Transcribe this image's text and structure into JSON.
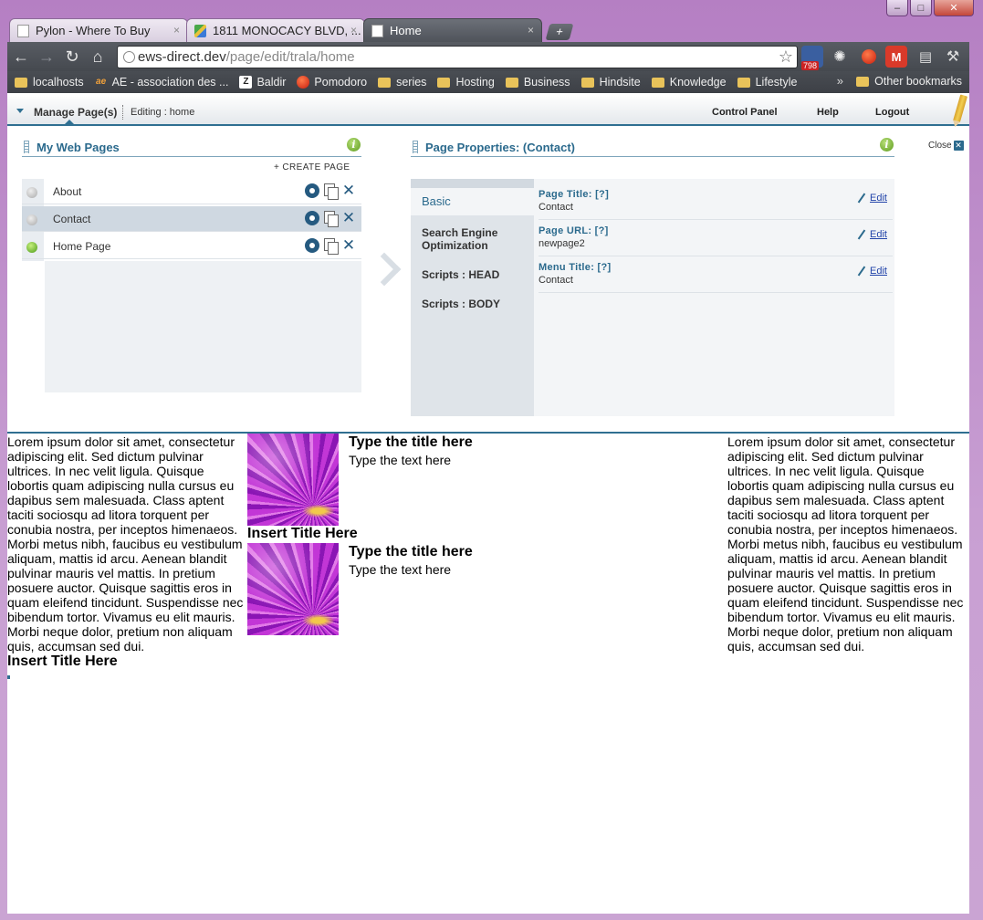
{
  "window": {
    "controls": {
      "minimize": "–",
      "maximize": "□",
      "close": "✕"
    }
  },
  "tabs": [
    {
      "title": "Pylon - Where To Buy",
      "icon": "page-icon",
      "close": "×"
    },
    {
      "title": "1811 MONOCACY BLVD, ...",
      "icon": "google-maps-icon",
      "close": "×"
    },
    {
      "title": "Home",
      "icon": "page-icon",
      "close": "×",
      "active": true
    }
  ],
  "new_tab": "+",
  "toolbar": {
    "back": "←",
    "forward": "→",
    "reload": "↻",
    "home": "⌂",
    "url_host": "ews-direct.dev",
    "url_path": "/page/edit/trala/home",
    "star": "☆",
    "rss_count": "798"
  },
  "bookmarks": {
    "items": [
      {
        "label": "localhosts",
        "icon": "folder-icon"
      },
      {
        "label": "AE - association des ...",
        "icon": "ae-logo-icon",
        "glyph": "ae"
      },
      {
        "label": "Baldir",
        "icon": "zotero-icon",
        "glyph": "Z"
      },
      {
        "label": "Pomodoro",
        "icon": "tomato-icon"
      },
      {
        "label": "series",
        "icon": "folder-icon"
      },
      {
        "label": "Hosting",
        "icon": "folder-icon"
      },
      {
        "label": "Business",
        "icon": "folder-icon"
      },
      {
        "label": "Hindsite",
        "icon": "folder-icon"
      },
      {
        "label": "Knowledge",
        "icon": "folder-icon"
      },
      {
        "label": "Lifestyle",
        "icon": "folder-icon"
      }
    ],
    "overflow": "»",
    "other": "Other bookmarks"
  },
  "cms": {
    "manage_label": "Manage Page(s)",
    "editing": "Editing : home",
    "links": [
      "Control Panel",
      "Help",
      "Logout"
    ]
  },
  "pages_panel": {
    "title": "My Web Pages",
    "create": "+ CREATE PAGE",
    "pages": [
      {
        "name": "About",
        "status": "inactive"
      },
      {
        "name": "Contact",
        "status": "inactive",
        "selected": true
      },
      {
        "name": "Home Page",
        "status": "active"
      }
    ]
  },
  "props_panel": {
    "title": "Page Properties: (Contact)",
    "close": "Close",
    "nav": [
      "Basic",
      "Search Engine Optimization",
      "Scripts : HEAD",
      "Scripts : BODY"
    ],
    "fields": [
      {
        "label": "Page Title: [?]",
        "value": "Contact",
        "edit": "Edit"
      },
      {
        "label": "Page URL: [?]",
        "value": "newpage2",
        "edit": "Edit"
      },
      {
        "label": "Menu Title: [?]",
        "value": "Contact",
        "edit": "Edit"
      }
    ]
  },
  "content": {
    "lorem_left": "Lorem ipsum dolor sit amet, consectetur adipiscing elit. Sed dictum pulvinar ultrices. In nec velit ligula. Quisque lobortis quam adipiscing nulla cursus eu dapibus sem malesuada. Class aptent taciti sociosqu ad litora torquent per conubia nostra, per inceptos himenaeos. Morbi metus nibh, faucibus eu vestibulum aliquam, mattis id arcu. Aenean blandit pulvinar mauris vel mattis. In pretium posuere auctor. Quisque sagittis eros in quam eleifend tincidunt. Suspendisse nec bibendum tortor. Vivamus eu elit mauris. Morbi neque dolor, pretium non aliquam quis, accumsan sed dui.",
    "lorem_right": "Lorem ipsum dolor sit amet, consectetur adipiscing elit. Sed dictum pulvinar ultrices. In nec velit ligula. Quisque lobortis quam adipiscing nulla cursus eu dapibus sem malesuada. Class aptent taciti sociosqu ad litora torquent per conubia nostra, per inceptos himenaeos. Morbi metus nibh, faucibus eu vestibulum aliquam, mattis id arcu. Aenean blandit pulvinar mauris vel mattis. In pretium posuere auctor. Quisque sagittis eros in quam eleifend tincidunt. Suspendisse nec bibendum tortor. Vivamus eu elit mauris. Morbi neque dolor, pretium non aliquam quis, accumsan sed dui.",
    "insert_title": "Insert Title Here",
    "blocks": [
      {
        "title": "Type the title here",
        "text": "Type the text here"
      },
      {
        "title": "Type the title here",
        "text": "Type the text here"
      }
    ]
  },
  "colors": {
    "accent": "#2f6f91",
    "window_frame": "#c7a3cf",
    "toolbar": "#4f535a"
  }
}
